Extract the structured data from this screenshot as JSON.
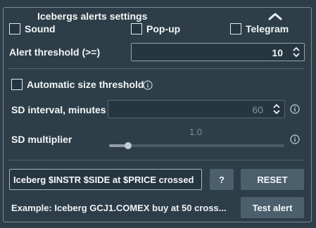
{
  "panel": {
    "title": "Icebergs alerts settings",
    "collapse_icon": "chevron-up-icon"
  },
  "notify": {
    "sound_label": "Sound",
    "popup_label": "Pop-up",
    "telegram_label": "Telegram",
    "sound_checked": false,
    "popup_checked": false,
    "telegram_checked": false
  },
  "alert_threshold": {
    "label": "Alert threshold (>=)",
    "value": "10"
  },
  "auto_size": {
    "label": "Automatic size threshold",
    "checked": false,
    "info_icon": "info-icon"
  },
  "sd_interval": {
    "label": "SD interval, minutes",
    "value": "60",
    "disabled": true
  },
  "sd_multiplier": {
    "label": "SD multiplier",
    "value": "1.0",
    "slider_fraction": 0.2,
    "disabled": true
  },
  "template": {
    "value": "Iceberg $INSTR $SIDE at $PRICE crossed",
    "help_label": "?",
    "reset_label": "RESET"
  },
  "example": {
    "text": "Example: Iceberg GCJ1.COMEX buy at 50 cross...",
    "test_label": "Test alert"
  },
  "colors": {
    "background": "#2d3e48",
    "button": "#4b5f6c",
    "border": "#7b8c96"
  }
}
